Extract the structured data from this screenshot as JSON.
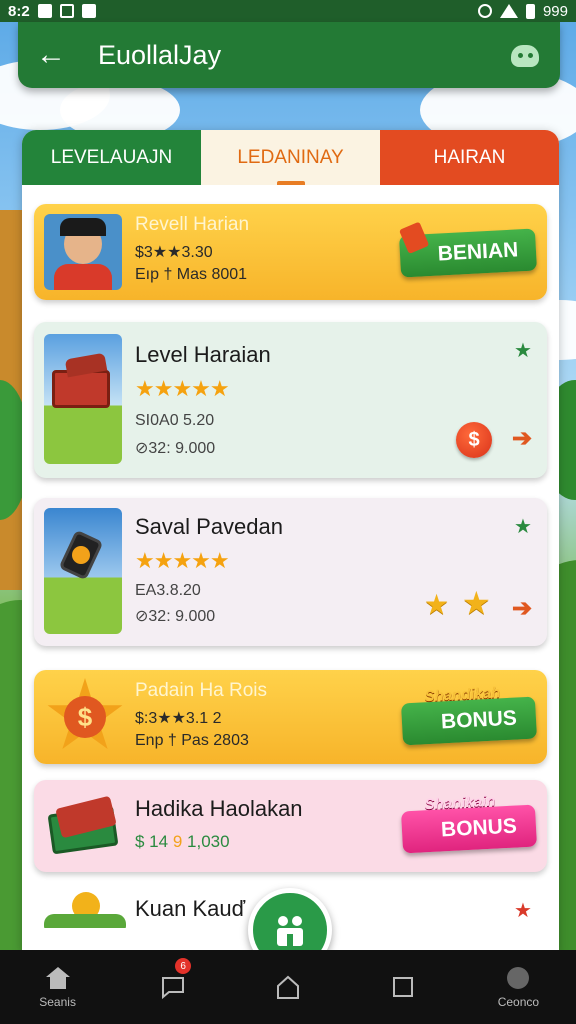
{
  "status_bar": {
    "time": "8:2",
    "battery": "999"
  },
  "app_bar": {
    "title": "EuollalJay"
  },
  "tabs": [
    {
      "label": "LEVELAUAJN"
    },
    {
      "label": "LEDANINAY"
    },
    {
      "label": "HAIRAN"
    }
  ],
  "items": [
    {
      "title": "Revell Harian",
      "line1": "$3★★3.30",
      "line2": "Eıp † Mas 8001",
      "badge_label": "BENIAN"
    },
    {
      "title": "Level Haraian",
      "rating": 5,
      "line1": "SI0A0 5.20",
      "line2": "⊘32: 9.000",
      "action_icon": "$"
    },
    {
      "title": "Saval Pavedan",
      "rating": 5,
      "line1": "EA3.8.20",
      "line2": "⊘32: 9.000"
    },
    {
      "title": "Padain Ha Rois",
      "line1": "$:3★★3.1 2",
      "line2": "Enp † Pas 2803",
      "badge_small": "Shandikah",
      "badge_label": "BONUS"
    },
    {
      "title": "Hadika Haolakan",
      "line1": "$ 14",
      "line1_highlight": "9",
      "line1_rest": "1,030",
      "badge_small": "Shanikain",
      "badge_label": "BONUS"
    },
    {
      "title": "Kuan Kauď"
    }
  ],
  "bottom_nav": [
    {
      "label": "Seanis",
      "icon": "home-icon"
    },
    {
      "label": "",
      "icon": "chat-icon",
      "badge": "6"
    },
    {
      "label": "",
      "icon": "house-outline-icon"
    },
    {
      "label": "",
      "icon": "square-icon"
    },
    {
      "label": "Ceonco",
      "icon": "profile-icon"
    }
  ],
  "colors": {
    "primary_green": "#237a35",
    "accent_orange": "#e87d24",
    "accent_red": "#e34b21",
    "card_yellow": "#ffd24a",
    "badge_magenta": "#e0247e"
  }
}
